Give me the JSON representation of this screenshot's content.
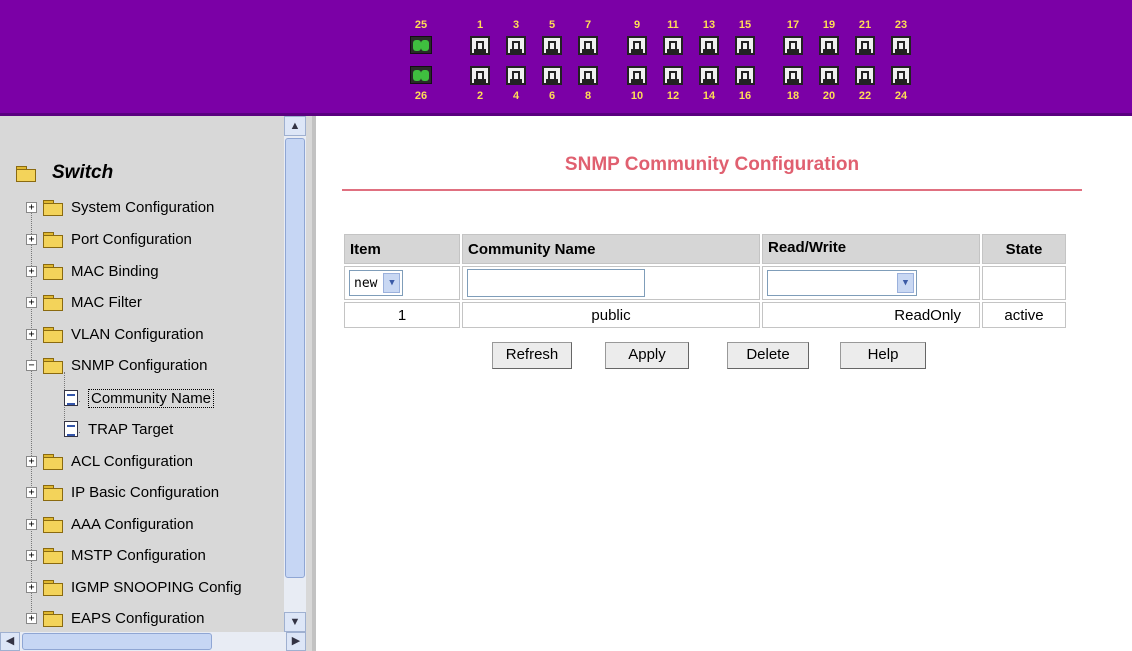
{
  "ports": {
    "fiber_top": "25",
    "fiber_bottom": "26",
    "top_groups": [
      [
        "1",
        "3",
        "5",
        "7"
      ],
      [
        "9",
        "11",
        "13",
        "15"
      ],
      [
        "17",
        "19",
        "21",
        "23"
      ]
    ],
    "bottom_groups": [
      [
        "2",
        "4",
        "6",
        "8"
      ],
      [
        "10",
        "12",
        "14",
        "16"
      ],
      [
        "18",
        "20",
        "22",
        "24"
      ]
    ]
  },
  "tree": {
    "root": "Switch",
    "items": [
      {
        "label": "System Configuration",
        "state": "+"
      },
      {
        "label": "Port Configuration",
        "state": "+"
      },
      {
        "label": "MAC Binding",
        "state": "+"
      },
      {
        "label": "MAC Filter",
        "state": "+"
      },
      {
        "label": "VLAN Configuration",
        "state": "+"
      },
      {
        "label": "SNMP Configuration",
        "state": "−"
      },
      {
        "label": "ACL Configuration",
        "state": "+"
      },
      {
        "label": "IP Basic Configuration",
        "state": "+"
      },
      {
        "label": "AAA Configuration",
        "state": "+"
      },
      {
        "label": "MSTP Configuration",
        "state": "+"
      },
      {
        "label": "IGMP SNOOPING Config",
        "state": "+"
      },
      {
        "label": "EAPS Configuration",
        "state": "+"
      }
    ],
    "snmp_children": [
      "Community Name",
      "TRAP Target"
    ],
    "selected": "Community Name"
  },
  "page": {
    "title": "SNMP Community Configuration",
    "columns": [
      "Item",
      "Community Name",
      "Read/Write",
      "State"
    ],
    "new_row": {
      "item_select": "new",
      "community_value": "",
      "rw_select": ""
    },
    "rows": [
      {
        "item": "1",
        "community": "public",
        "rw": "ReadOnly",
        "state": "active"
      }
    ],
    "buttons": {
      "refresh": "Refresh",
      "apply": "Apply",
      "delete": "Delete",
      "help": "Help"
    }
  },
  "colors": {
    "banner": "#7b00a6",
    "title": "#e06070",
    "port_numbers": "#ffdd55"
  }
}
